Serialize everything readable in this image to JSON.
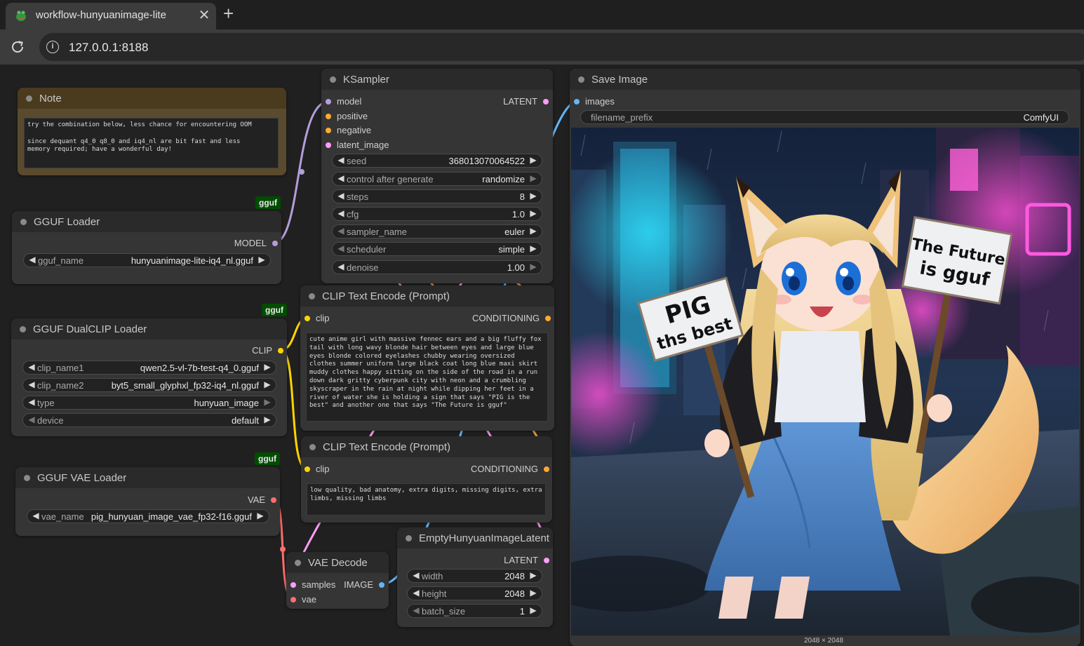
{
  "browser": {
    "tab_title": "workflow-hunyuanimage-lite",
    "url": "127.0.0.1:8188",
    "close_symbol": "✕",
    "newtab_symbol": "+"
  },
  "colors": {
    "model": "#b39ddb",
    "clip": "#ffd500",
    "conditioning": "#ffa931",
    "latent": "#ff9cf9",
    "vae": "#ff6e6e",
    "image": "#64b5f6"
  },
  "nodes": {
    "note": {
      "title": "Note",
      "text": "try the combination below, less chance for encountering OOM\n\nsince dequant q4_0 q8_0 and iq4_nl are bit fast and less\nmemory required; have a wonderful day!"
    },
    "gguf_loader": {
      "badge": "gguf",
      "title": "GGUF Loader",
      "output": "MODEL",
      "widget": {
        "label": "gguf_name",
        "value": "hunyuanimage-lite-iq4_nl.gguf"
      }
    },
    "dualclip": {
      "badge": "gguf",
      "title": "GGUF DualCLIP Loader",
      "output": "CLIP",
      "widgets": [
        {
          "label": "clip_name1",
          "value": "qwen2.5-vl-7b-test-q4_0.gguf"
        },
        {
          "label": "clip_name2",
          "value": "byt5_small_glyphxl_fp32-iq4_nl.gguf"
        },
        {
          "label": "type",
          "value": "hunyuan_image"
        },
        {
          "label": "device",
          "value": "default"
        }
      ]
    },
    "vae_loader": {
      "badge": "gguf",
      "title": "GGUF VAE Loader",
      "output": "VAE",
      "widget": {
        "label": "vae_name",
        "value": "pig_hunyuan_image_vae_fp32-f16.gguf"
      }
    },
    "ksampler": {
      "title": "KSampler",
      "inputs": [
        "model",
        "positive",
        "negative",
        "latent_image"
      ],
      "output": "LATENT",
      "widgets": [
        {
          "label": "seed",
          "value": "368013070064522"
        },
        {
          "label": "control after generate",
          "value": "randomize"
        },
        {
          "label": "steps",
          "value": "8"
        },
        {
          "label": "cfg",
          "value": "1.0"
        },
        {
          "label": "sampler_name",
          "value": "euler"
        },
        {
          "label": "scheduler",
          "value": "simple"
        },
        {
          "label": "denoise",
          "value": "1.00"
        }
      ]
    },
    "clip_pos": {
      "title": "CLIP Text Encode (Prompt)",
      "input": "clip",
      "output": "CONDITIONING",
      "text": "cute anime girl with massive fennec ears and a big fluffy fox tail with long wavy blonde hair between eyes and large blue eyes blonde colored eyelashes chubby wearing oversized clothes summer uniform large black coat long blue maxi skirt muddy clothes happy sitting on the side of the road in a run down dark gritty cyberpunk city with neon and a crumbling skyscraper in the rain at night while dipping her feet in a river of water she is holding a sign that says \"PIG is the best\" and another one that says \"The Future is gguf\""
    },
    "clip_neg": {
      "title": "CLIP Text Encode (Prompt)",
      "input": "clip",
      "output": "CONDITIONING",
      "text": "low quality, bad anatomy, extra digits, missing digits, extra limbs, missing limbs"
    },
    "latent": {
      "title": "EmptyHunyuanImageLatent",
      "output": "LATENT",
      "widgets": [
        {
          "label": "width",
          "value": "2048"
        },
        {
          "label": "height",
          "value": "2048"
        },
        {
          "label": "batch_size",
          "value": "1"
        }
      ]
    },
    "vae_decode": {
      "title": "VAE Decode",
      "inputs": [
        "samples",
        "vae"
      ],
      "output": "IMAGE"
    },
    "save": {
      "title": "Save Image",
      "input": "images",
      "widget": {
        "label": "filename_prefix",
        "value": "ComfyUI"
      },
      "sign_left": [
        "PIG",
        "ths best"
      ],
      "sign_right": [
        "The Future",
        "is gguf"
      ],
      "caption": "2048 × 2048"
    }
  }
}
